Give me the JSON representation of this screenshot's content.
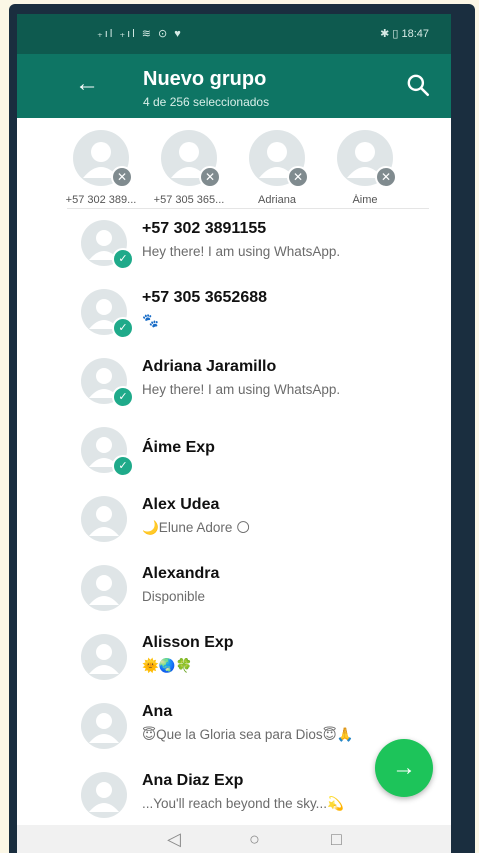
{
  "statusbar": {
    "left_icons": "₊ıl ₊ıl ≋ ⊙ ♥",
    "right": "✱ ▯ 18:47"
  },
  "header": {
    "title": "Nuevo grupo",
    "subtitle": "4 de 256 seleccionados",
    "back_icon": "arrow-left-icon",
    "search_icon": "search-icon"
  },
  "selected": [
    {
      "label": "+57 302 389..."
    },
    {
      "label": "+57 305 365..."
    },
    {
      "label": "Adriana"
    },
    {
      "label": "Áime"
    }
  ],
  "contacts": [
    {
      "name": "+57 302 3891155",
      "status": "Hey there! I am using WhatsApp.",
      "selected": true
    },
    {
      "name": "+57 305 3652688",
      "status": "🐾",
      "selected": true
    },
    {
      "name": "Adriana Jaramillo",
      "status": "Hey there! I am using WhatsApp.",
      "selected": true
    },
    {
      "name": "Áime Exp",
      "status": "",
      "selected": true
    },
    {
      "name": "Alex Udea",
      "status": "🌙Elune Adore 🌕",
      "selected": false
    },
    {
      "name": "Alexandra",
      "status": "Disponible",
      "selected": false
    },
    {
      "name": "Alisson Exp",
      "status": "🌞🌏🍀",
      "selected": false
    },
    {
      "name": "Ana",
      "status": "😇Que la Gloria sea para Dios😇🙏",
      "selected": false
    },
    {
      "name": "Ana Diaz Exp",
      "status": "...You'll reach beyond the sky...💫",
      "selected": false
    }
  ],
  "fab": {
    "icon": "→"
  },
  "navbar": {
    "back": "◁",
    "home": "○",
    "recent": "□"
  },
  "colors": {
    "appbar": "#0e7564",
    "statusbar": "#0e5a4f",
    "accent": "#1faa8a",
    "fab": "#1dc45a"
  }
}
